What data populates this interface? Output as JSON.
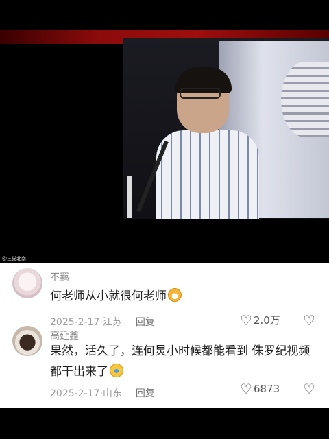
{
  "video": {
    "watermark": "@三猫北南"
  },
  "comments": [
    {
      "user": "不羁",
      "text": "何老师从小就很何老师",
      "emoji": "grinning-face-icon",
      "date": "2025-2-17",
      "location": "江苏",
      "reply_label": "回复",
      "likes": "2.0万"
    },
    {
      "user": "高延鑫",
      "text": "果然，活久了，连何炅小时候都能看到 侏罗纪视频都干出来了",
      "emoji": "laughing-face-icon",
      "date": "2025-2-17",
      "location": "山东",
      "reply_label": "回复",
      "likes": "6873"
    }
  ]
}
